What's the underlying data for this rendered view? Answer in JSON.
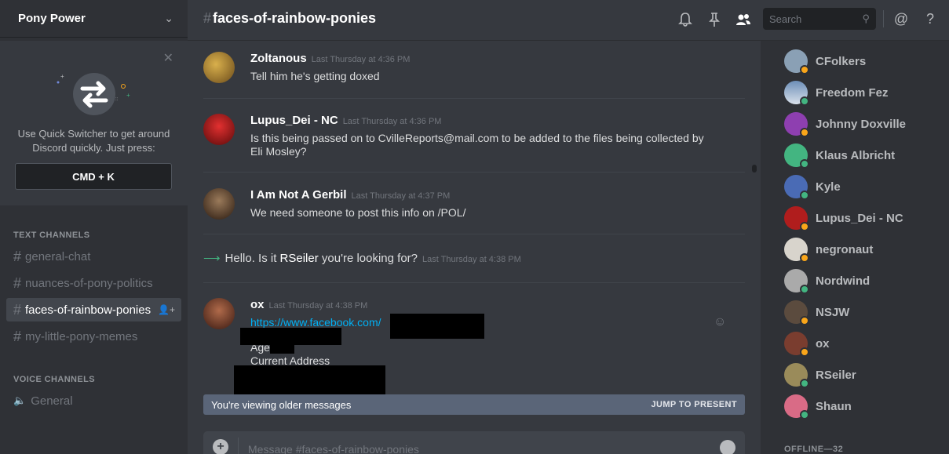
{
  "server": {
    "name": "Pony Power"
  },
  "quick_switcher": {
    "text_line1": "Use Quick Switcher to get around",
    "text_line2": "Discord quickly. Just press:",
    "shortcut": "CMD + K"
  },
  "sidebar": {
    "text_category": "TEXT CHANNELS",
    "voice_category": "VOICE CHANNELS",
    "text_channels": [
      "general-chat",
      "nuances-of-pony-politics",
      "faces-of-rainbow-ponies",
      "my-little-pony-memes"
    ],
    "voice_channels": [
      "General"
    ],
    "active_channel_index": 2
  },
  "header": {
    "channel": "faces-of-rainbow-ponies",
    "search_placeholder": "Search"
  },
  "messages": [
    {
      "author": "Zoltanous",
      "timestamp": "Last Thursday at 4:36 PM",
      "text": "Tell him he's getting doxed",
      "avatar_color": "#b28a3c"
    },
    {
      "author": "Lupus_Dei - NC",
      "timestamp": "Last Thursday at 4:36 PM",
      "text_line1": "Is this being passed on to CvilleReports@mail.com to be added to the files being collected by",
      "text_line2": "Eli Mosley?",
      "avatar_color": "#b01d1d"
    },
    {
      "author": "I Am Not A Gerbil",
      "timestamp": "Last Thursday at 4:37 PM",
      "text": "We need someone to post this info on /POL/",
      "avatar_color": "#6b4a2e"
    },
    {
      "author": "ox",
      "timestamp": "Last Thursday at 4:38 PM",
      "link": "https://www.facebook.com/",
      "line_age": "Age",
      "line_address": "Current Address",
      "avatar_color": "#7a3d2f"
    }
  ],
  "system_message": {
    "prefix": "Hello. Is it ",
    "user": "RSeiler",
    "suffix": " you're looking for?",
    "timestamp": "Last Thursday at 4:38 PM"
  },
  "older_bar": {
    "text": "You're viewing older messages",
    "jump": "JUMP TO PRESENT"
  },
  "composer": {
    "placeholder": "Message #faces-of-rainbow-ponies"
  },
  "members": [
    {
      "name": "CFolkers",
      "status": "idle",
      "color": "#8aa0b5"
    },
    {
      "name": "Freedom Fez",
      "status": "online",
      "color": "#6d8fb8"
    },
    {
      "name": "Johnny Doxville",
      "status": "idle",
      "color": "#8e3fb0"
    },
    {
      "name": "Klaus Albricht",
      "status": "online",
      "color": "#43b581"
    },
    {
      "name": "Kyle",
      "status": "online",
      "color": "#4a6bb5"
    },
    {
      "name": "Lupus_Dei - NC",
      "status": "idle",
      "color": "#b01d1d"
    },
    {
      "name": "negronaut",
      "status": "idle",
      "color": "#d8d4cc"
    },
    {
      "name": "Nordwind",
      "status": "online",
      "color": "#aaaaaa"
    },
    {
      "name": "NSJW",
      "status": "idle",
      "color": "#5b4b3e"
    },
    {
      "name": "ox",
      "status": "idle",
      "color": "#7a3d2f"
    },
    {
      "name": "RSeiler",
      "status": "online",
      "color": "#9a8b5a"
    },
    {
      "name": "Shaun",
      "status": "online",
      "color": "#d96b86"
    }
  ],
  "offline_label": "OFFLINE—32",
  "colors": {
    "online": "#43b581",
    "idle": "#faa61a",
    "accent": "#7289da"
  }
}
